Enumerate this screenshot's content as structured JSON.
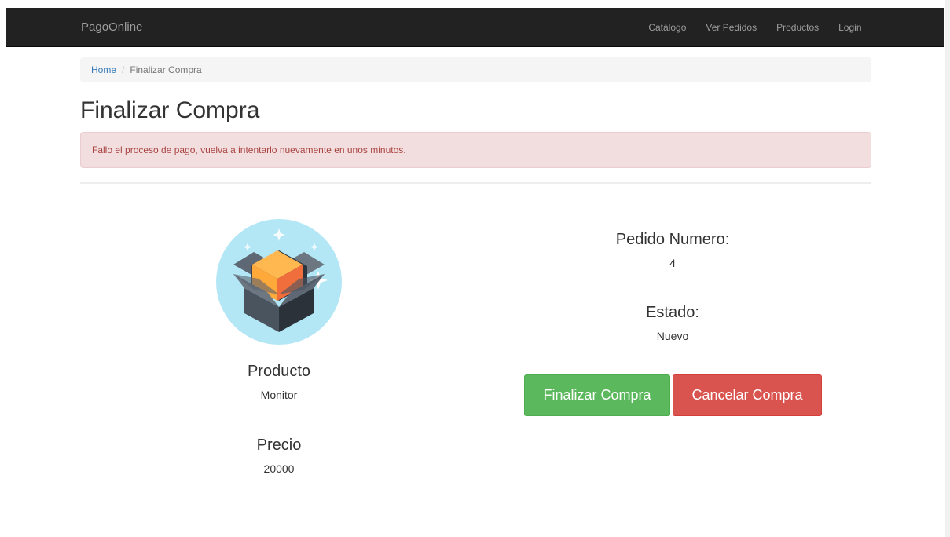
{
  "navbar": {
    "brand": "PagoOnline",
    "links": [
      "Catálogo",
      "Ver Pedidos",
      "Productos",
      "Login"
    ]
  },
  "breadcrumb": {
    "home": "Home",
    "separator": "/",
    "current": "Finalizar Compra"
  },
  "page": {
    "title": "Finalizar Compra"
  },
  "alert": {
    "message": "Fallo el proceso de pago, vuelva a intentarlo nuevamente en unos minutos."
  },
  "product": {
    "image_icon": "open-box-icon",
    "name_label": "Producto",
    "name_value": "Monitor",
    "price_label": "Precio",
    "price_value": "20000"
  },
  "order": {
    "number_label": "Pedido Numero:",
    "number_value": "4",
    "status_label": "Estado:",
    "status_value": "Nuevo"
  },
  "actions": {
    "finalize_label": "Finalizar Compra",
    "cancel_label": "Cancelar Compra"
  },
  "colors": {
    "navbar": "#222222",
    "link": "#337ab7",
    "alert_bg": "#f2dede",
    "alert_text": "#a94442",
    "success": "#5cb85c",
    "danger": "#d9534f"
  }
}
